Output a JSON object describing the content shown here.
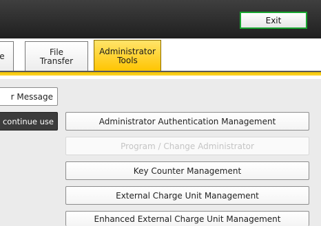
{
  "header": {
    "exit_label": "Exit"
  },
  "tabs": [
    {
      "label": "e",
      "selected": false
    },
    {
      "line1": "File",
      "line2": "Transfer",
      "selected": false
    },
    {
      "line1": "Administrator",
      "line2": "Tools",
      "selected": true
    }
  ],
  "side": {
    "message_label": "r Message",
    "continue_label": "continue use"
  },
  "menu": [
    {
      "label": "Administrator Authentication Management",
      "enabled": true
    },
    {
      "label": "Program / Change Administrator",
      "enabled": false
    },
    {
      "label": "Key Counter Management",
      "enabled": true
    },
    {
      "label": "External Charge Unit Management",
      "enabled": true
    },
    {
      "label": "Enhanced External Charge Unit Management",
      "enabled": true
    }
  ],
  "colors": {
    "selected_tab": "#ffc400",
    "exit_border": "#17a52f",
    "title_bar": "#2a2a2a"
  }
}
